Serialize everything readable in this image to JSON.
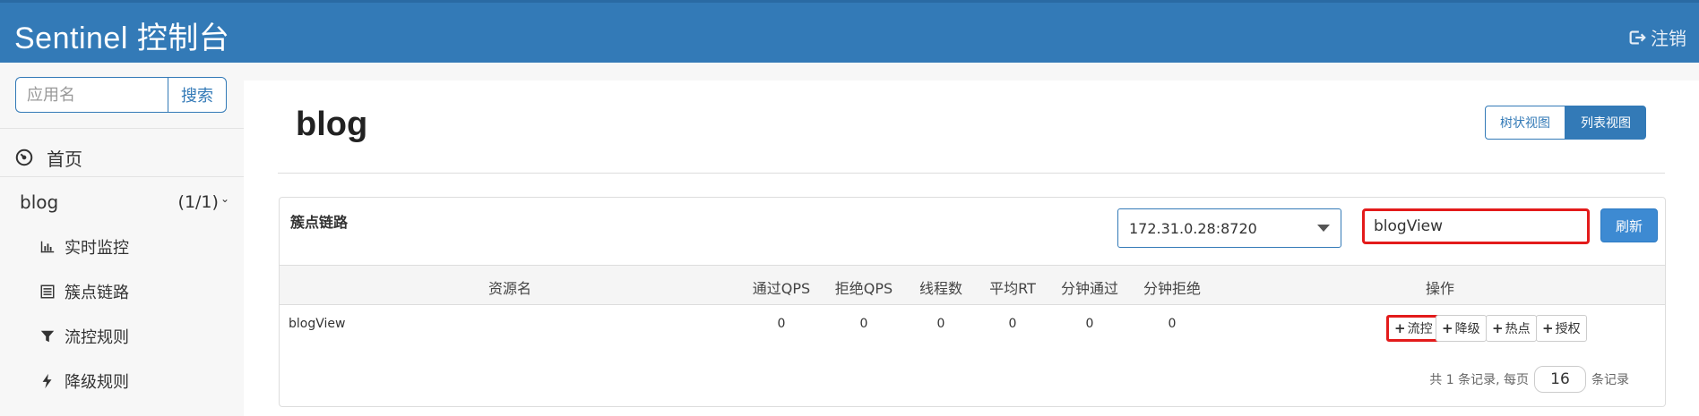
{
  "header": {
    "title": "Sentinel 控制台",
    "logout_label": "注销"
  },
  "sidebar": {
    "search": {
      "placeholder": "应用名",
      "button_label": "搜索"
    },
    "home_label": "首页",
    "app": {
      "name": "blog",
      "count": "(1/1)"
    },
    "items": [
      {
        "label": "实时监控",
        "icon": "bar-chart-icon"
      },
      {
        "label": "簇点链路",
        "icon": "list-icon"
      },
      {
        "label": "流控规则",
        "icon": "filter-icon"
      },
      {
        "label": "降级规则",
        "icon": "bolt-icon"
      }
    ]
  },
  "main": {
    "page_title": "blog",
    "view_toggle": {
      "tree_label": "树状视图",
      "list_label": "列表视图",
      "active": "list"
    },
    "panel": {
      "title": "簇点链路",
      "machine": "172.31.0.28:8720",
      "filter_value": "blogView",
      "refresh_label": "刷新",
      "columns": [
        "资源名",
        "通过QPS",
        "拒绝QPS",
        "线程数",
        "平均RT",
        "分钟通过",
        "分钟拒绝",
        "操作"
      ],
      "rows": [
        {
          "resource": "blogView",
          "pass_qps": "0",
          "block_qps": "0",
          "threads": "0",
          "avg_rt": "0",
          "minute_pass": "0",
          "minute_block": "0"
        }
      ],
      "ops": [
        "流控",
        "降级",
        "热点",
        "授权"
      ],
      "pager": {
        "prefix": "共 1 条记录, 每页",
        "page_size": "16",
        "suffix": "条记录"
      }
    }
  },
  "colors": {
    "header_bg": "#337ab7",
    "accent": "#337ab7",
    "highlight": "#e31b1b",
    "refresh_bg": "#3d8ad2"
  }
}
